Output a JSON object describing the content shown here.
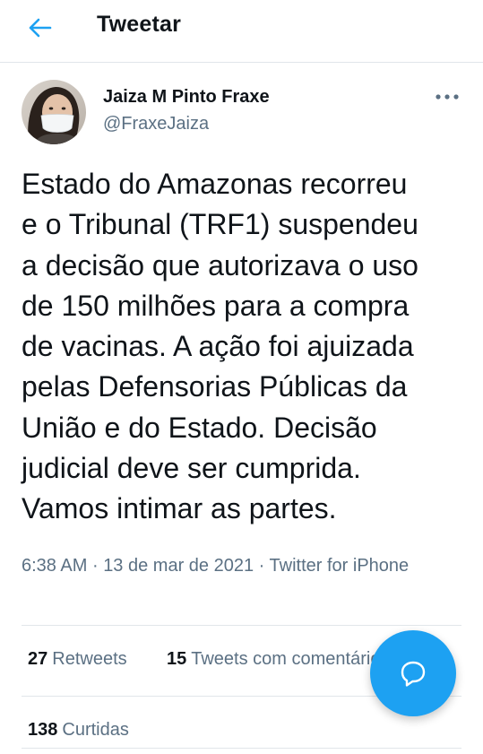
{
  "header": {
    "title": "Tweetar",
    "back_icon": "arrow-left-icon"
  },
  "tweet": {
    "author": {
      "name": "Jaiza M Pinto Fraxe",
      "handle": "@FraxeJaiza"
    },
    "text": "Estado do Amazonas recorreu\ne o Tribunal (TRF1) suspendeu\na decisão que autorizava o uso\nde 150 milhões para a compra\nde vacinas. A ação foi ajuizada\npelas Defensorias Públicas da\nUnião e do Estado. Decisão\njudicial deve ser cumprida.\nVamos intimar as partes.",
    "time": "6:38 AM",
    "separator": "·",
    "date": "13 de mar de 2021",
    "source": "Twitter for iPhone",
    "stats": {
      "retweets_count": "27",
      "retweets_label": "Retweets",
      "quote_count": "15",
      "quote_label": "Tweets com comentário",
      "likes_count": "138",
      "likes_label": "Curtidas"
    }
  },
  "fab": {
    "icon": "reply-bubble-icon"
  },
  "colors": {
    "accent": "#1da1f2",
    "secondary_text": "#5b7083",
    "primary_text": "#0f1419",
    "divider": "#e1e6ea"
  }
}
